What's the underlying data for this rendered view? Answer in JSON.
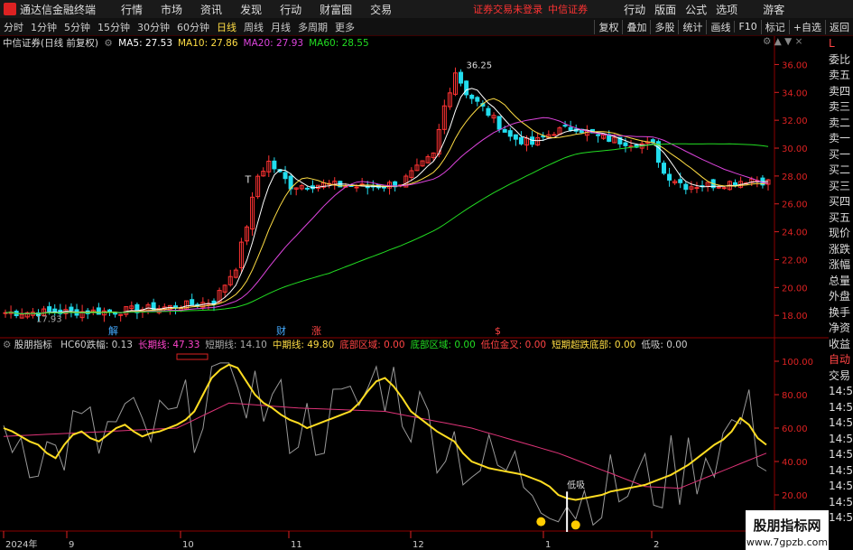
{
  "menubar": {
    "app_title": "通达信金融终端",
    "items": [
      "行情",
      "市场",
      "资讯",
      "发现",
      "行动",
      "财富圈",
      "交易"
    ],
    "warning": "证券交易未登录",
    "broker": "中信证券",
    "right_items": [
      "行动",
      "版面",
      "公式",
      "选项"
    ],
    "guest": "游客"
  },
  "toolbar": {
    "periods": [
      "分时",
      "1分钟",
      "5分钟",
      "15分钟",
      "30分钟",
      "60分钟",
      "日线",
      "周线",
      "月线",
      "多周期",
      "更多"
    ],
    "active_period": "日线",
    "right_buttons": [
      "复权",
      "叠加",
      "多股",
      "统计",
      "画线",
      "F10",
      "标记",
      "+自选",
      "返回"
    ]
  },
  "stock": {
    "name": "中信证券(日线 前复权)",
    "ma": [
      {
        "label": "MA5: 27.53",
        "color": "#ffffff"
      },
      {
        "label": "MA10: 27.86",
        "color": "#ffdd44"
      },
      {
        "label": "MA20: 27.93",
        "color": "#dd44dd"
      },
      {
        "label": "MA60: 28.55",
        "color": "#22dd22"
      }
    ],
    "high_label": "36.25",
    "low_label": "17.93",
    "t_label": "T"
  },
  "price_axis": [
    "36.00",
    "34.00",
    "32.00",
    "30.00",
    "28.00",
    "26.00",
    "24.00",
    "22.00",
    "20.00",
    "18.00"
  ],
  "markers": [
    {
      "text": "解",
      "color": "#44aaff"
    },
    {
      "text": "财",
      "color": "#44aaff"
    },
    {
      "text": "涨",
      "color": "#ff4444"
    },
    {
      "text": "$",
      "color": "#ff4444"
    }
  ],
  "indicator": {
    "name": "股朋指标",
    "params": [
      {
        "label": "HC60跌幅: 0.13",
        "color": "#cccccc"
      },
      {
        "label": "长期线: 47.33",
        "color": "#ff44cc"
      },
      {
        "label": "短期线: 14.10",
        "color": "#aaaaaa"
      },
      {
        "label": "中期线: 49.80",
        "color": "#ffdd44"
      },
      {
        "label": "底部区域: 0.00",
        "color": "#ff4444"
      },
      {
        "label": "底部区域: 0.00",
        "color": "#22dd22"
      },
      {
        "label": "低位金叉: 0.00",
        "color": "#ff4444"
      },
      {
        "label": "短期超跌底部: 0.00",
        "color": "#ffdd44"
      },
      {
        "label": "低吸: 0.00",
        "color": "#cccccc"
      }
    ],
    "axis": [
      "100.00",
      "80.00",
      "60.00",
      "40.00",
      "20.00"
    ],
    "low_buy_label": "低吸"
  },
  "date_axis": [
    "2024年",
    "9",
    "10",
    "11",
    "12",
    "1",
    "2"
  ],
  "right_panel": {
    "items": [
      {
        "t": "L",
        "c": "red"
      },
      {
        "t": "委比",
        "c": ""
      },
      {
        "t": "卖五",
        "c": ""
      },
      {
        "t": "卖四",
        "c": ""
      },
      {
        "t": "卖三",
        "c": ""
      },
      {
        "t": "卖二",
        "c": ""
      },
      {
        "t": "卖一",
        "c": ""
      },
      {
        "t": "买一",
        "c": ""
      },
      {
        "t": "买二",
        "c": ""
      },
      {
        "t": "买三",
        "c": ""
      },
      {
        "t": "买四",
        "c": ""
      },
      {
        "t": "买五",
        "c": ""
      },
      {
        "t": "现价",
        "c": ""
      },
      {
        "t": "涨跌",
        "c": ""
      },
      {
        "t": "涨幅",
        "c": ""
      },
      {
        "t": "总量",
        "c": ""
      },
      {
        "t": "外盘",
        "c": ""
      },
      {
        "t": "换手",
        "c": ""
      },
      {
        "t": "净资",
        "c": ""
      },
      {
        "t": "收益",
        "c": ""
      },
      {
        "t": "自动",
        "c": "red"
      },
      {
        "t": "交易",
        "c": ""
      },
      {
        "t": "14:5",
        "c": ""
      },
      {
        "t": "14:5",
        "c": ""
      },
      {
        "t": "14:5",
        "c": ""
      },
      {
        "t": "14:5",
        "c": ""
      },
      {
        "t": "14:5",
        "c": ""
      },
      {
        "t": "14:5",
        "c": ""
      },
      {
        "t": "14:5",
        "c": ""
      },
      {
        "t": "14:5",
        "c": ""
      },
      {
        "t": "14:5",
        "c": ""
      }
    ]
  },
  "watermark": {
    "title": "股朋指标网",
    "url": "www.7gpzb.com"
  }
}
